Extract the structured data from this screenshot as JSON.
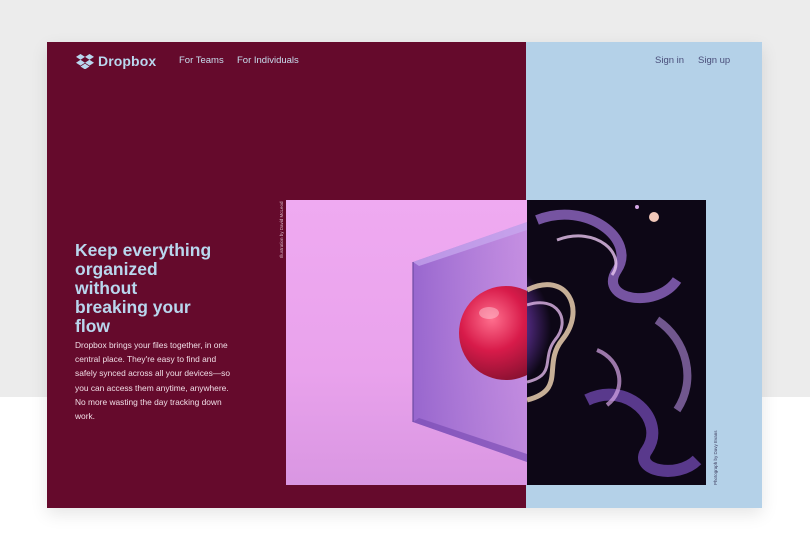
{
  "brand": {
    "name": "Dropbox"
  },
  "nav": {
    "links": [
      "For Teams",
      "For Individuals"
    ],
    "sign_in": "Sign in",
    "sign_up": "Sign up"
  },
  "hero": {
    "headline_lines": [
      "Keep everything",
      "organized",
      "without",
      "breaking your",
      "flow"
    ],
    "body": "Dropbox brings your files together, in one central place. They're easy to find and safely synced across all your devices—so you can access them anytime, anywhere. No more wasting the day tracking down work."
  },
  "credits": {
    "illustration": "Illustration by David McLeod",
    "photograph": "Photograph by Davy Evans"
  },
  "colors": {
    "left_panel": "#650a2c",
    "right_panel": "#b4d1e8",
    "headline": "#b9d7ee",
    "art_pink": "#efaaf1"
  },
  "icons": {
    "logo": "dropbox-logo-icon"
  }
}
